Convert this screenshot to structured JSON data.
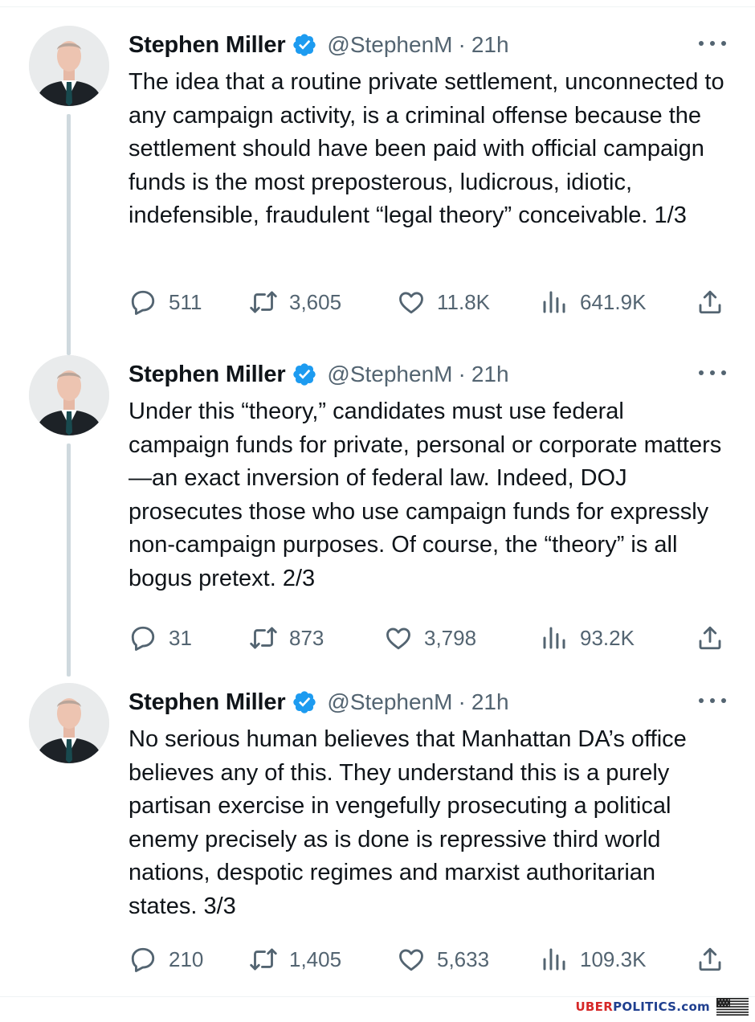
{
  "author": {
    "name": "Stephen Miller",
    "handle": "@StephenM",
    "separator": "·",
    "verified_icon": "verified-badge-icon",
    "verified_color": "#1d9bf0"
  },
  "tweets": [
    {
      "time": "21h",
      "text": "The idea that a routine private settlement, unconnected to any campaign activity, is a criminal offense because the settlement should have been paid with official campaign funds is the most preposterous, ludicrous, idiotic, indefensible, fraudulent “legal theory” conceivable. 1/3",
      "replies": "511",
      "retweets": "3,605",
      "likes": "11.8K",
      "views": "641.9K"
    },
    {
      "time": "21h",
      "text": "Under this “theory,” candidates must use federal campaign funds for private, personal or corporate matters—an exact inversion of federal law. Indeed, DOJ prosecutes those who use campaign funds for expressly non-campaign purposes. Of course, the “theory” is all bogus pretext. 2/3",
      "replies": "31",
      "retweets": "873",
      "likes": "3,798",
      "views": "93.2K"
    },
    {
      "time": "21h",
      "text": "No serious human believes that Manhattan DA’s office believes any of this. They understand this is a purely partisan exercise in vengefully prosecuting a political enemy precisely as is done is repressive third world nations, despotic regimes and marxist authoritarian states. 3/3",
      "replies": "210",
      "retweets": "1,405",
      "likes": "5,633",
      "views": "109.3K"
    }
  ],
  "icons": {
    "reply": "reply-icon",
    "retweet": "retweet-icon",
    "like": "heart-icon",
    "views": "views-icon",
    "share": "share-icon",
    "more": "more-options-icon"
  },
  "watermark": {
    "part1": "UBER",
    "part2": "POLITICS",
    "part3": ".com",
    "flag_icon": "us-flag-icon",
    "color_red": "#d62828",
    "color_blue": "#1f3f8f"
  },
  "colors": {
    "text": "#0f1419",
    "secondary": "#536471",
    "thread_line": "#cfd9de"
  }
}
